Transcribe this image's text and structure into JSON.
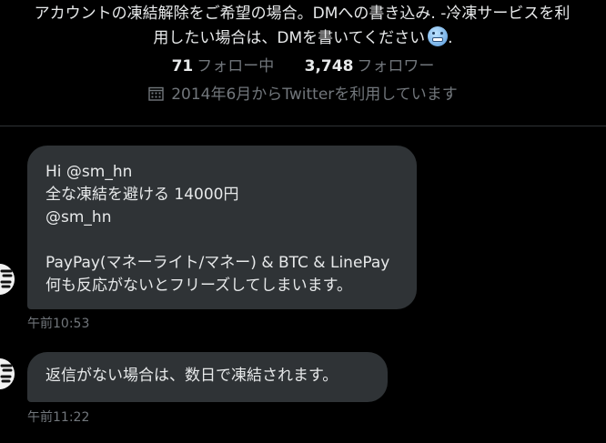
{
  "profile": {
    "bio_line1": "アカウントの凍結解除をご希望の場合。DMへの書き込み. -冷凍サービスを利",
    "bio_line2": "用したい場合は、DMを書いてください",
    "bio_line2_end": ".",
    "bio_emoji": "cold-face-emoji",
    "following_count": "71",
    "following_label": "フォロー中",
    "followers_count": "3,748",
    "followers_label": "フォロワー",
    "joined_text": "2014年6月からTwitterを利用しています",
    "joined_icon": "calendar-icon"
  },
  "messages": [
    {
      "lines": [
        "Hi @sm_hn",
        "全な凍結を避ける 14000円",
        "@sm_hn",
        "",
        "PayPay(マネーライト/マネー) & BTC & LinePay",
        "何も反応がないとフリーズしてしまいます。"
      ],
      "time": "午前10:53"
    },
    {
      "lines": [
        "返信がない場合は、数日で凍結されます。"
      ],
      "time": "午前11:22"
    }
  ],
  "colors": {
    "background": "#000000",
    "bubble": "#2f3336",
    "text": "#e7e9ea",
    "muted": "#71767b",
    "divider": "#2f3336"
  }
}
